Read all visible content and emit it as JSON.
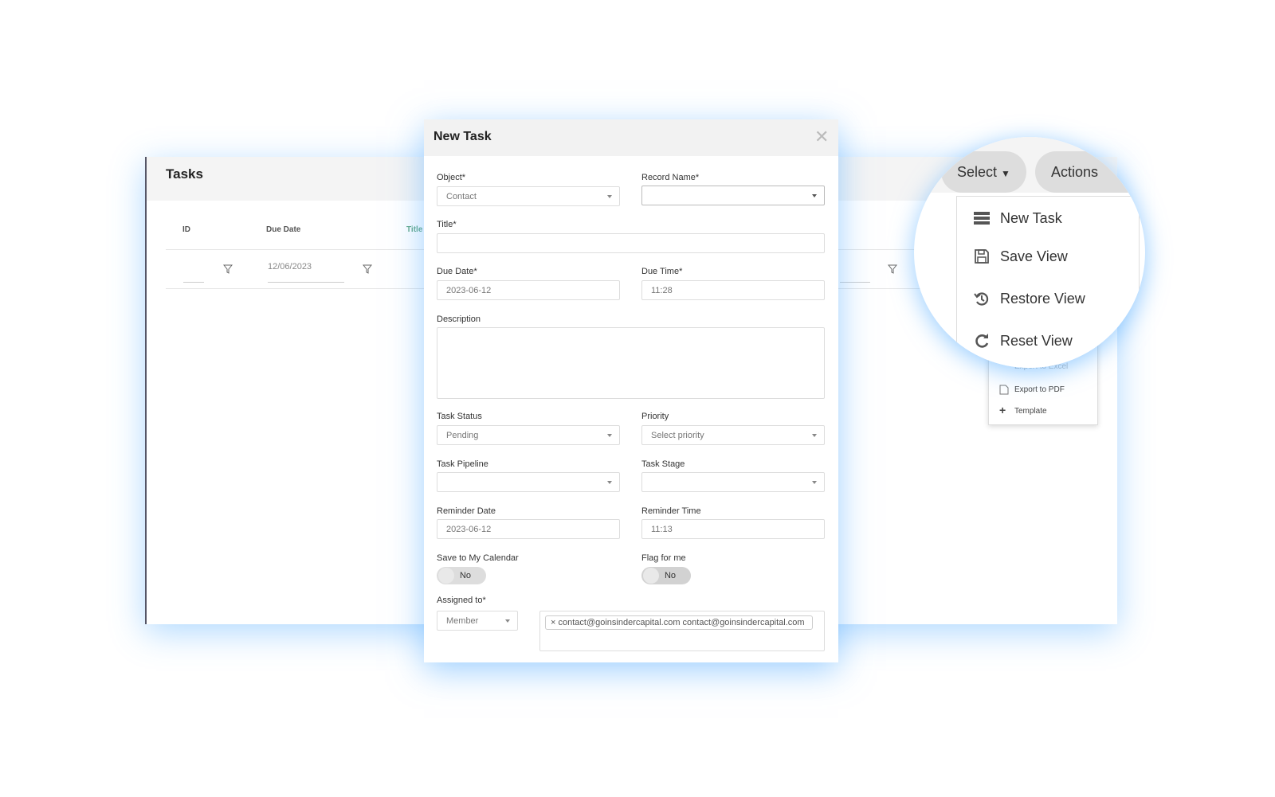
{
  "tasks_panel": {
    "title": "Tasks",
    "columns": [
      "ID",
      "Due Date",
      "Title"
    ],
    "filters": {
      "id": "",
      "due_date": "12/06/2023"
    }
  },
  "modal": {
    "title": "New Task",
    "close_icon": "close-icon",
    "fields": {
      "object": {
        "label": "Object*",
        "value": "Contact"
      },
      "record_name": {
        "label": "Record Name*",
        "value": ""
      },
      "title": {
        "label": "Title*",
        "value": ""
      },
      "due_date": {
        "label": "Due Date*",
        "value": "2023-06-12"
      },
      "due_time": {
        "label": "Due Time*",
        "value": "11:28"
      },
      "description": {
        "label": "Description",
        "value": ""
      },
      "task_status": {
        "label": "Task Status",
        "value": "Pending"
      },
      "priority": {
        "label": "Priority",
        "placeholder": "Select priority"
      },
      "task_pipeline": {
        "label": "Task Pipeline",
        "value": ""
      },
      "task_stage": {
        "label": "Task Stage",
        "value": ""
      },
      "reminder_date": {
        "label": "Reminder Date",
        "value": "2023-06-12"
      },
      "reminder_time": {
        "label": "Reminder Time",
        "value": "11:13"
      },
      "save_calendar": {
        "label": "Save to My Calendar",
        "value": "No"
      },
      "flag": {
        "label": "Flag for me",
        "value": "No"
      },
      "assigned": {
        "label": "Assigned to*",
        "type": "Member",
        "chip": "× contact@goinsindercapital.com contact@goinsindercapital.com"
      }
    }
  },
  "toolbar": {
    "select": "Select",
    "actions": "Actions"
  },
  "actions_menu": {
    "items": [
      {
        "label": "New Task",
        "icon": "list-icon"
      },
      {
        "label": "Save View",
        "icon": "save-icon"
      },
      {
        "label": "Restore View",
        "icon": "restore-icon"
      },
      {
        "label": "Reset View",
        "icon": "reset-icon"
      }
    ],
    "more_items": [
      {
        "label": "Export to Excel",
        "icon": "excel-icon"
      },
      {
        "label": "Export to PDF",
        "icon": "pdf-icon"
      },
      {
        "label": "Template",
        "icon": "plus-icon"
      }
    ]
  }
}
